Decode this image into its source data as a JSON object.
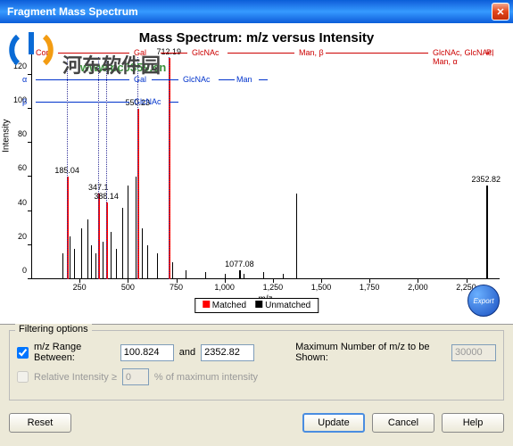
{
  "window": {
    "title": "Fragment Mass Spectrum"
  },
  "chart": {
    "title": "Mass Spectrum: m/z versus Intensity",
    "xlabel": "m/z",
    "ylabel": "Intensity",
    "legend": {
      "matched": "Matched",
      "unmatched": "Unmatched"
    },
    "export": "Export"
  },
  "chart_data": {
    "type": "bar",
    "xlabel": "m/z",
    "ylabel": "Intensity",
    "xlim": [
      0,
      2400
    ],
    "ylim": [
      0,
      135
    ],
    "xticks": [
      250,
      500,
      750,
      1000,
      1250,
      1500,
      1750,
      2000,
      2250
    ],
    "yticks": [
      0,
      20,
      40,
      60,
      80,
      100,
      120
    ],
    "top_annotations_red": {
      "Core": 5,
      "Gal": 115,
      "GlcNAc": 180,
      "Man, β": 300,
      "GlcNAc, GlcNAc, Man, α": 450,
      "PI": 510
    },
    "row_annotations_blue": {
      "alpha": {
        "label": "α",
        "Gal": 115,
        "GlcNAc": 170,
        "Man": 230
      },
      "beta": {
        "label": "β",
        "GlcNAc": 115
      }
    },
    "peaks_labeled": [
      {
        "mz": 185.04,
        "intensity": 60,
        "matched": true
      },
      {
        "mz": 347.1,
        "intensity": 50,
        "matched": true
      },
      {
        "mz": 388.14,
        "intensity": 45,
        "matched": true
      },
      {
        "mz": 550.23,
        "intensity": 100,
        "matched": true
      },
      {
        "mz": 712.19,
        "intensity": 130,
        "matched": true
      },
      {
        "mz": 1077.08,
        "intensity": 5,
        "matched": false
      },
      {
        "mz": 2352.82,
        "intensity": 55,
        "matched": false
      }
    ],
    "unlabeled_peaks": [
      {
        "mz": 160,
        "intensity": 15
      },
      {
        "mz": 200,
        "intensity": 25
      },
      {
        "mz": 220,
        "intensity": 18
      },
      {
        "mz": 260,
        "intensity": 30
      },
      {
        "mz": 290,
        "intensity": 35
      },
      {
        "mz": 310,
        "intensity": 20
      },
      {
        "mz": 330,
        "intensity": 15
      },
      {
        "mz": 370,
        "intensity": 22
      },
      {
        "mz": 410,
        "intensity": 28
      },
      {
        "mz": 440,
        "intensity": 18
      },
      {
        "mz": 470,
        "intensity": 42
      },
      {
        "mz": 500,
        "intensity": 55
      },
      {
        "mz": 540,
        "intensity": 60
      },
      {
        "mz": 570,
        "intensity": 30
      },
      {
        "mz": 600,
        "intensity": 20
      },
      {
        "mz": 650,
        "intensity": 15
      },
      {
        "mz": 730,
        "intensity": 10
      },
      {
        "mz": 800,
        "intensity": 5
      },
      {
        "mz": 900,
        "intensity": 4
      },
      {
        "mz": 1000,
        "intensity": 3
      },
      {
        "mz": 1100,
        "intensity": 3
      },
      {
        "mz": 1200,
        "intensity": 4
      },
      {
        "mz": 1300,
        "intensity": 3
      },
      {
        "mz": 1370,
        "intensity": 50
      }
    ]
  },
  "filter": {
    "heading": "Filtering options",
    "range_label": "m/z Range Between:",
    "range_min": "100.824",
    "range_and": "and",
    "range_max": "2352.82",
    "max_label": "Maximum Number of m/z to be Shown:",
    "max_value": "30000",
    "rel_label": "Relative Intensity ≥",
    "rel_value": "0",
    "rel_suffix": "% of maximum intensity"
  },
  "buttons": {
    "reset": "Reset",
    "update": "Update",
    "cancel": "Cancel",
    "help": "Help"
  }
}
